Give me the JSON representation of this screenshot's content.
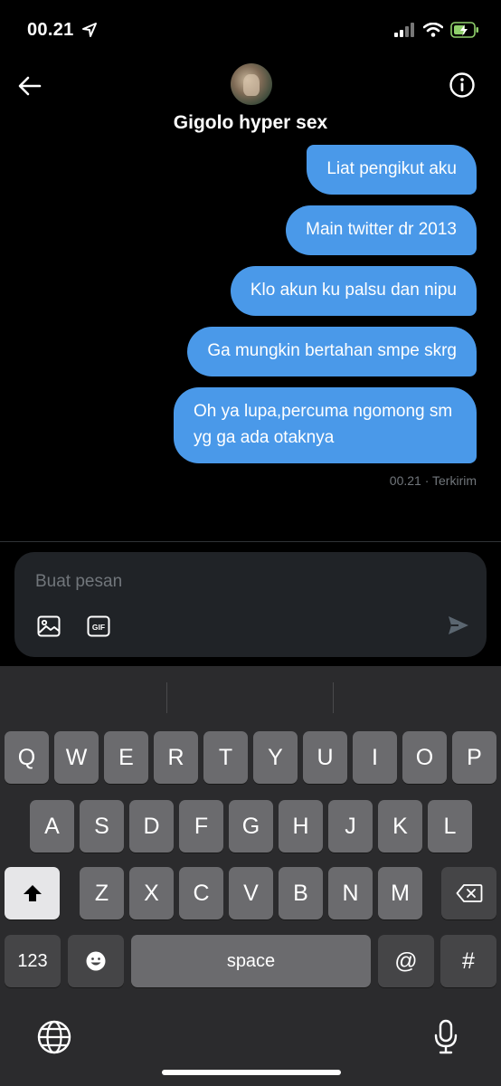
{
  "status_bar": {
    "time": "00.21"
  },
  "header": {
    "contact_name": "Gigolo hyper sex"
  },
  "messages": [
    "Liat pengikut aku",
    "Main twitter dr 2013",
    "Klo akun ku palsu dan nipu",
    "Ga mungkin bertahan smpe skrg",
    "Oh ya lupa,percuma ngomong sm yg ga ada otaknya"
  ],
  "message_meta": "00.21 · Terkirim",
  "composer": {
    "placeholder": "Buat pesan"
  },
  "keyboard": {
    "row1": [
      "Q",
      "W",
      "E",
      "R",
      "T",
      "Y",
      "U",
      "I",
      "O",
      "P"
    ],
    "row2": [
      "A",
      "S",
      "D",
      "F",
      "G",
      "H",
      "J",
      "K",
      "L"
    ],
    "row3": [
      "Z",
      "X",
      "C",
      "V",
      "B",
      "N",
      "M"
    ],
    "numbers_label": "123",
    "space_label": "space",
    "at_label": "@",
    "hash_label": "#"
  },
  "colors": {
    "bubble": "#4a99e9",
    "background": "#000000",
    "composer": "#202327",
    "keyboard": "#2b2b2d"
  },
  "icons": {
    "back": "arrow-left-icon",
    "info": "info-icon",
    "media": "image-icon",
    "gif": "gif-icon",
    "send": "send-icon",
    "shift": "shift-icon",
    "delete": "backspace-icon",
    "emoji": "emoji-icon",
    "globe": "globe-icon",
    "mic": "microphone-icon"
  }
}
